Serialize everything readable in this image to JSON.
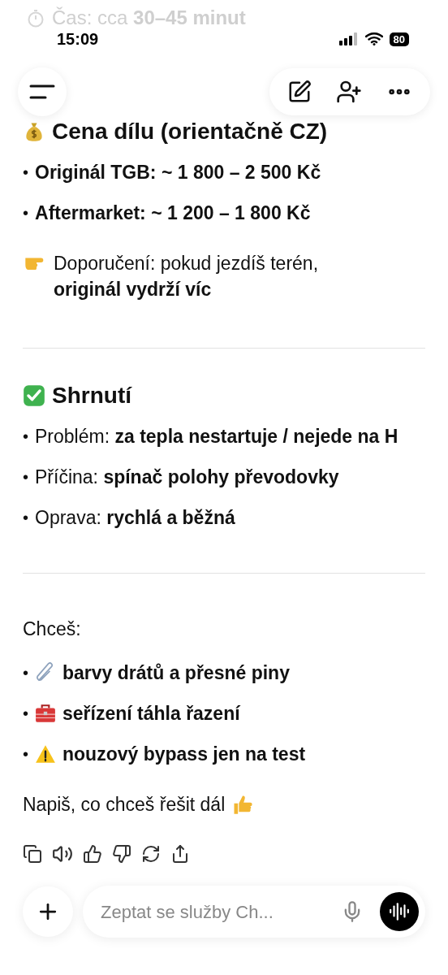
{
  "ghost_line": {
    "text": "Čas: cca **30–45 minut**"
  },
  "status_bar": {
    "time": "15:09",
    "battery": "80"
  },
  "blocks": [
    {
      "kind": "heading",
      "text": "Cena dílu (orientačně CZ)"
    },
    {
      "kind": "bullet",
      "bullet": "•",
      "bold": true,
      "text": "Originál TGB: ~ 1 800 – 2 500 Kč"
    },
    {
      "kind": "bullet",
      "bullet": "•",
      "bold": true,
      "text": "Aftermarket: ~ 1 200 – 1 800 Kč"
    },
    {
      "kind": "paragraph",
      "text": "Doporučení: pokud jezdíš terén, **originál vydrží víc**"
    },
    {
      "kind": "divider"
    },
    {
      "kind": "heading",
      "text": "Shrnutí"
    },
    {
      "kind": "bullet",
      "bullet": "•",
      "bold": false,
      "text": "Problém: **za tepla nestartuje / nejede na H**"
    },
    {
      "kind": "bullet",
      "bullet": "•",
      "bold": false,
      "text": "Příčina: **spínač polohy převodovky**"
    },
    {
      "kind": "bullet",
      "bullet": "•",
      "bold": false,
      "text": "Oprava: **rychlá a běžná**"
    },
    {
      "kind": "divider"
    },
    {
      "kind": "paragraph",
      "text": "Chceš:"
    },
    {
      "kind": "bullet",
      "bullet": "•",
      "bold": true,
      "text": "barvy drátů a přesné piny"
    },
    {
      "kind": "bullet",
      "bullet": "•",
      "bold": true,
      "text": "seřízení táhla řazení"
    },
    {
      "kind": "bullet",
      "bullet": "•",
      "bold": true,
      "text": "nouzový bypass jen na test"
    },
    {
      "kind": "paragraph",
      "text": "Napiš, co chceš řešit dál"
    }
  ],
  "composer": {
    "placeholder": "Zeptat se služby Ch..."
  }
}
